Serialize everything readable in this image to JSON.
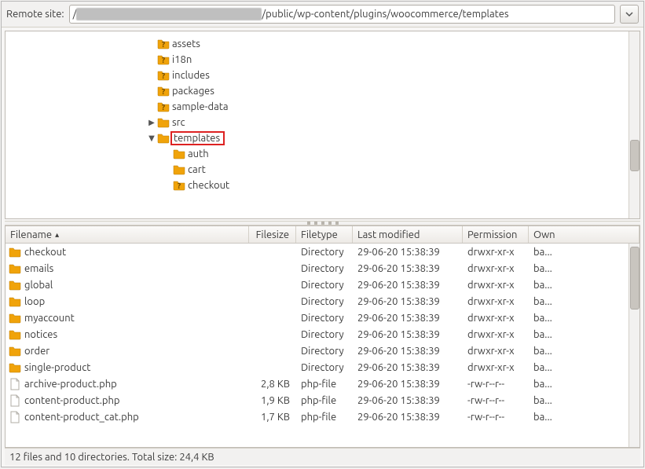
{
  "remote": {
    "label": "Remote site:",
    "path_prefix": "/",
    "path_suffix": "/public/wp-content/plugins/woocommerce/templates"
  },
  "tree": {
    "items": [
      {
        "indent": 180,
        "icon": "folder-q",
        "label": "assets"
      },
      {
        "indent": 180,
        "icon": "folder-q",
        "label": "i18n"
      },
      {
        "indent": 180,
        "icon": "folder-q",
        "label": "includes"
      },
      {
        "indent": 180,
        "icon": "folder-q",
        "label": "packages"
      },
      {
        "indent": 180,
        "icon": "folder-q",
        "label": "sample-data"
      },
      {
        "indent": 180,
        "icon": "folder",
        "label": "src",
        "expander": "right"
      },
      {
        "indent": 180,
        "icon": "folder",
        "label": "templates",
        "expander": "down",
        "selected": true
      },
      {
        "indent": 200,
        "icon": "folder",
        "label": "auth"
      },
      {
        "indent": 200,
        "icon": "folder",
        "label": "cart"
      },
      {
        "indent": 200,
        "icon": "folder-q",
        "label": "checkout"
      }
    ]
  },
  "columns": {
    "filename": "Filename",
    "filesize": "Filesize",
    "filetype": "Filetype",
    "lastmod": "Last modified",
    "permission": "Permission",
    "owner": "Own"
  },
  "rows": [
    {
      "icon": "folder",
      "name": "checkout",
      "size": "",
      "type": "Directory",
      "mod": "29-06-20 15:38:39",
      "perm": "drwxr-xr-x",
      "own": "ba..."
    },
    {
      "icon": "folder",
      "name": "emails",
      "size": "",
      "type": "Directory",
      "mod": "29-06-20 15:38:39",
      "perm": "drwxr-xr-x",
      "own": "ba..."
    },
    {
      "icon": "folder",
      "name": "global",
      "size": "",
      "type": "Directory",
      "mod": "29-06-20 15:38:39",
      "perm": "drwxr-xr-x",
      "own": "ba..."
    },
    {
      "icon": "folder",
      "name": "loop",
      "size": "",
      "type": "Directory",
      "mod": "29-06-20 15:38:39",
      "perm": "drwxr-xr-x",
      "own": "ba..."
    },
    {
      "icon": "folder",
      "name": "myaccount",
      "size": "",
      "type": "Directory",
      "mod": "29-06-20 15:38:39",
      "perm": "drwxr-xr-x",
      "own": "ba..."
    },
    {
      "icon": "folder",
      "name": "notices",
      "size": "",
      "type": "Directory",
      "mod": "29-06-20 15:38:39",
      "perm": "drwxr-xr-x",
      "own": "ba..."
    },
    {
      "icon": "folder",
      "name": "order",
      "size": "",
      "type": "Directory",
      "mod": "29-06-20 15:38:39",
      "perm": "drwxr-xr-x",
      "own": "ba..."
    },
    {
      "icon": "folder",
      "name": "single-product",
      "size": "",
      "type": "Directory",
      "mod": "29-06-20 15:38:39",
      "perm": "drwxr-xr-x",
      "own": "ba..."
    },
    {
      "icon": "file",
      "name": "archive-product.php",
      "size": "2,8 KB",
      "type": "php-file",
      "mod": "29-06-20 15:38:39",
      "perm": "-rw-r--r--",
      "own": "ba..."
    },
    {
      "icon": "file",
      "name": "content-product.php",
      "size": "1,9 KB",
      "type": "php-file",
      "mod": "29-06-20 15:38:39",
      "perm": "-rw-r--r--",
      "own": "ba..."
    },
    {
      "icon": "file",
      "name": "content-product_cat.php",
      "size": "1,7 KB",
      "type": "php-file",
      "mod": "29-06-20 15:38:39",
      "perm": "-rw-r--r--",
      "own": "ba..."
    }
  ],
  "status": "12 files and 10 directories. Total size: 24,4 KB"
}
